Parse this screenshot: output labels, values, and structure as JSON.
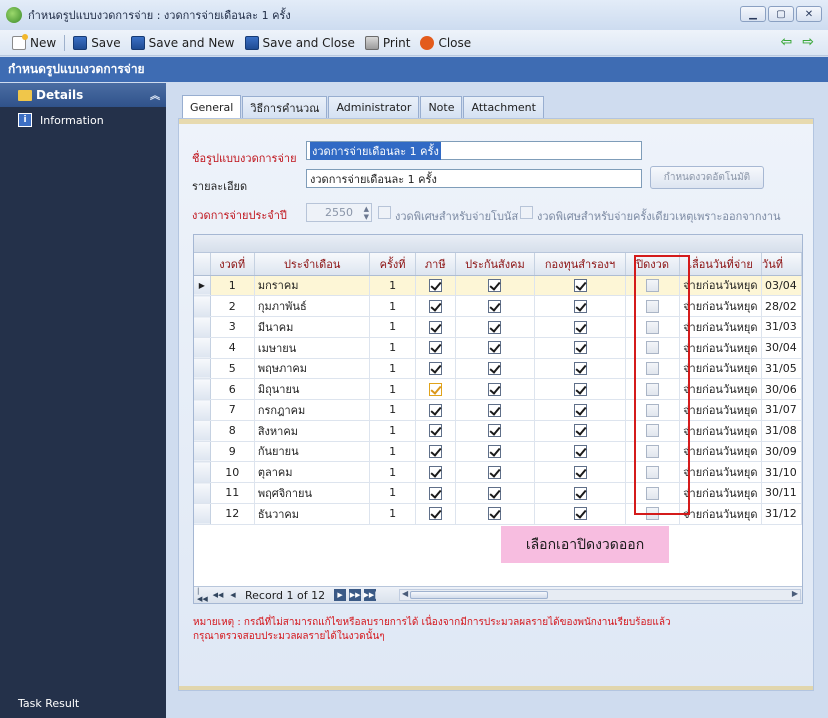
{
  "window": {
    "title": "กำหนดรูปแบบงวดการจ่าย : งวดการจ่ายเดือนละ 1 ครั้ง",
    "buttons": [
      "minimize-icon",
      "maximize-icon",
      "close-icon"
    ]
  },
  "toolbar": {
    "new": "New",
    "save": "Save",
    "save_new": "Save and New",
    "save_close": "Save and Close",
    "print": "Print",
    "close": "Close"
  },
  "header": {
    "title": "กำหนดรูปแบบงวดการจ่าย"
  },
  "sidebar": {
    "section": "Details",
    "items": [
      {
        "label": "Information"
      }
    ],
    "footer": "Task Result"
  },
  "tabs": [
    {
      "label": "General",
      "active": true
    },
    {
      "label": "วิธีการคำนวณ"
    },
    {
      "label": "Administrator"
    },
    {
      "label": "Note"
    },
    {
      "label": "Attachment"
    }
  ],
  "form": {
    "name_label": "ชื่อรูปแบบงวดการจ่าย",
    "name_value": "งวดการจ่ายเดือนละ 1 ครั้ง",
    "desc_label": "รายละเอียด",
    "desc_value": "งวดการจ่ายเดือนละ 1 ครั้ง",
    "auto_button": "กำหนดงวดอัตโนมัติ",
    "year_label": "งวดการจ่ายประจำปี",
    "year_value": "2550",
    "bonus_label": "งวดพิเศษสำหรับจ่ายโบนัส",
    "onetime_label": "งวดพิเศษสำหรับจ่ายครั้งเดียวเหตุเพราะออกจากงาน"
  },
  "grid": {
    "columns": [
      "งวดที่",
      "ประจำเดือน",
      "ครั้งที่",
      "ภาษี",
      "ประกันสังคม",
      "กองทุนสำรองฯ",
      "ปิดงวด",
      "เลื่อนวันที่จ่าย",
      "วันที่"
    ],
    "rows": [
      {
        "no": "1",
        "month": "มกราคม",
        "times": "1",
        "tax": true,
        "sso": true,
        "fund": true,
        "closed": false,
        "shift": "จ่ายก่อนวันหยุด",
        "date": "03/04"
      },
      {
        "no": "2",
        "month": "กุมภาพันธ์",
        "times": "1",
        "tax": true,
        "sso": true,
        "fund": true,
        "closed": false,
        "shift": "จ่ายก่อนวันหยุด",
        "date": "28/02"
      },
      {
        "no": "3",
        "month": "มีนาคม",
        "times": "1",
        "tax": true,
        "sso": true,
        "fund": true,
        "closed": false,
        "shift": "จ่ายก่อนวันหยุด",
        "date": "31/03"
      },
      {
        "no": "4",
        "month": "เมษายน",
        "times": "1",
        "tax": true,
        "sso": true,
        "fund": true,
        "closed": false,
        "shift": "จ่ายก่อนวันหยุด",
        "date": "30/04"
      },
      {
        "no": "5",
        "month": "พฤษภาคม",
        "times": "1",
        "tax": true,
        "sso": true,
        "fund": true,
        "closed": false,
        "shift": "จ่ายก่อนวันหยุด",
        "date": "31/05"
      },
      {
        "no": "6",
        "month": "มิถุนายน",
        "times": "1",
        "tax": true,
        "sso": true,
        "fund": true,
        "closed": false,
        "shift": "จ่ายก่อนวันหยุด",
        "date": "30/06"
      },
      {
        "no": "7",
        "month": "กรกฎาคม",
        "times": "1",
        "tax": true,
        "sso": true,
        "fund": true,
        "closed": false,
        "shift": "จ่ายก่อนวันหยุด",
        "date": "31/07"
      },
      {
        "no": "8",
        "month": "สิงหาคม",
        "times": "1",
        "tax": true,
        "sso": true,
        "fund": true,
        "closed": false,
        "shift": "จ่ายก่อนวันหยุด",
        "date": "31/08"
      },
      {
        "no": "9",
        "month": "กันยายน",
        "times": "1",
        "tax": true,
        "sso": true,
        "fund": true,
        "closed": false,
        "shift": "จ่ายก่อนวันหยุด",
        "date": "30/09"
      },
      {
        "no": "10",
        "month": "ตุลาคม",
        "times": "1",
        "tax": true,
        "sso": true,
        "fund": true,
        "closed": false,
        "shift": "จ่ายก่อนวันหยุด",
        "date": "31/10"
      },
      {
        "no": "11",
        "month": "พฤศจิกายน",
        "times": "1",
        "tax": true,
        "sso": true,
        "fund": true,
        "closed": false,
        "shift": "จ่ายก่อนวันหยุด",
        "date": "30/11"
      },
      {
        "no": "12",
        "month": "ธันวาคม",
        "times": "1",
        "tax": true,
        "sso": true,
        "fund": true,
        "closed": false,
        "shift": "จ่ายก่อนวันหยุด",
        "date": "31/12"
      }
    ],
    "record_label": "Record 1 of 12"
  },
  "callout": "เลือกเอาปิดงวดออก",
  "note_lines": [
    "หมายเหตุ : กรณีที่ไม่สามารถแก้ไขหรือลบรายการได้ เนื่องจากมีการประมวลผลรายได้ของพนักงานเรียบร้อยแล้ว",
    "กรุณาตรวจสอบประมวลผลรายได้ในงวดนั้นๆ"
  ],
  "colors": {
    "accent": "#3e6cb3",
    "sidebar": "#24314a",
    "label_red": "#c0141c",
    "highlight_box": "#d41b1b",
    "callout": "#f7bde0"
  }
}
